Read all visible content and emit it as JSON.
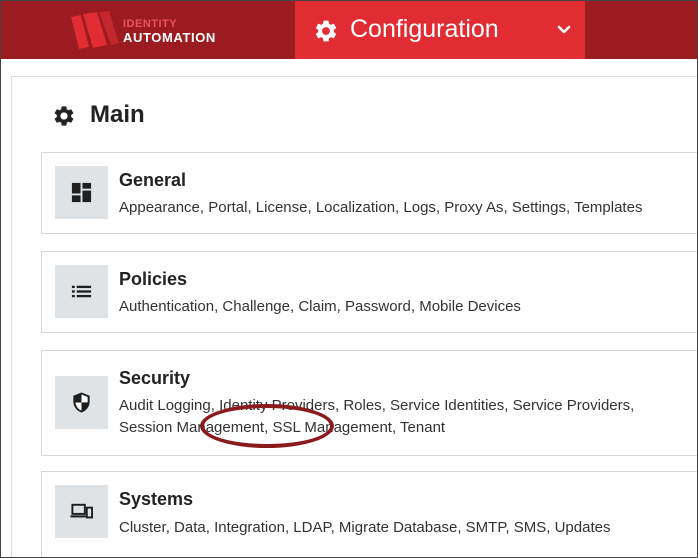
{
  "header": {
    "logo": {
      "line1": "IDENTITY",
      "line2": "AUTOMATION"
    },
    "menu": {
      "label": "Configuration",
      "icon": "gear-icon",
      "chevron_icon": "chevron-down-icon"
    },
    "colors": {
      "bar": "#9b1b20",
      "menu": "#e02c32"
    }
  },
  "page": {
    "title": "Main",
    "title_icon": "gear-icon"
  },
  "cards": [
    {
      "title": "General",
      "icon": "dashboard-icon",
      "links": [
        "Appearance",
        "Portal",
        "License",
        "Localization",
        "Logs",
        "Proxy As",
        "Settings",
        "Templates"
      ]
    },
    {
      "title": "Policies",
      "icon": "list-icon",
      "links": [
        "Authentication",
        "Challenge",
        "Claim",
        "Password",
        "Mobile Devices"
      ]
    },
    {
      "title": "Security",
      "icon": "shield-icon",
      "links": [
        "Audit Logging",
        "Identity Providers",
        "Roles",
        "Service Identities",
        "Service Providers",
        "Session Management",
        "SSL Management",
        "Tenant"
      ]
    },
    {
      "title": "Systems",
      "icon": "devices-icon",
      "links": [
        "Cluster",
        "Data",
        "Integration",
        "LDAP",
        "Migrate Database",
        "SMTP",
        "SMS",
        "Updates"
      ]
    }
  ],
  "annotation": {
    "highlighted_link": "SSL Management",
    "color": "#8b1a1f"
  }
}
